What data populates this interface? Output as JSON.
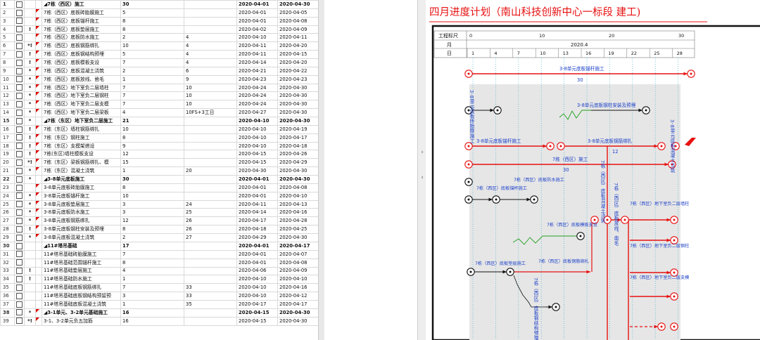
{
  "grid": {
    "rows": [
      {
        "n": "1",
        "mark": "",
        "tri": false,
        "sum": true,
        "name": "◢7栋（西区）施工",
        "dur": "30",
        "free": "",
        "start": "2020-04-01",
        "end": "2020-04-30"
      },
      {
        "n": "2",
        "mark": "",
        "tri": true,
        "sum": false,
        "name": "7栋（西区）底板砖胎膜施工",
        "dur": "5",
        "free": "",
        "start": "2020-04-01",
        "end": "2020-04-05"
      },
      {
        "n": "3",
        "mark": "",
        "tri": true,
        "sum": false,
        "name": "7栋（西区）底板锚杆施工",
        "dur": "8",
        "free": "",
        "start": "2020-04-01",
        "end": "2020-04-08"
      },
      {
        "n": "4",
        "mark": "!",
        "tri": true,
        "sum": false,
        "name": "7栋（西区）底板垫层施工",
        "dur": "8",
        "free": "",
        "start": "2020-04-02",
        "end": "2020-04-09"
      },
      {
        "n": "5",
        "mark": "",
        "tri": true,
        "sum": false,
        "name": "7栋（西区）底板防水施工",
        "dur": "2",
        "free": "4",
        "start": "2020-04-10",
        "end": "2020-04-11"
      },
      {
        "n": "6",
        "mark": "*!",
        "tri": true,
        "sum": false,
        "name": "7栋（西区）底板钢筋绑扎",
        "dur": "10",
        "free": "4",
        "start": "2020-04-11",
        "end": "2020-04-20"
      },
      {
        "n": "7",
        "mark": "!",
        "tri": true,
        "sum": false,
        "name": "7栋（西区）底板钢结构预埋",
        "dur": "5",
        "free": "4",
        "start": "2020-04-11",
        "end": "2020-04-15"
      },
      {
        "n": "8",
        "mark": "!",
        "tri": true,
        "sum": false,
        "name": "7栋（西区）底板模板支设",
        "dur": "7",
        "free": "4",
        "start": "2020-04-14",
        "end": "2020-04-20"
      },
      {
        "n": "9",
        "mark": "*",
        "tri": true,
        "sum": false,
        "name": "7栋（西区）底板混凝土浇筑",
        "dur": "2",
        "free": "6",
        "start": "2020-04-21",
        "end": "2020-04-22"
      },
      {
        "n": "10",
        "mark": "*",
        "tri": true,
        "sum": false,
        "name": "7栋（西区）底板放线、凿毛",
        "dur": "1",
        "free": "9",
        "start": "2020-04-23",
        "end": "2020-04-23"
      },
      {
        "n": "11",
        "mark": "*",
        "tri": true,
        "sum": false,
        "name": "7栋（西区）地下室负二层墙柱",
        "dur": "7",
        "free": "10",
        "start": "2020-04-24",
        "end": "2020-04-30"
      },
      {
        "n": "12",
        "mark": "*",
        "tri": true,
        "sum": false,
        "name": "7栋（西区）地下室负二层钢柱",
        "dur": "7",
        "free": "10",
        "start": "2020-04-24",
        "end": "2020-04-30"
      },
      {
        "n": "13",
        "mark": "*",
        "tri": true,
        "sum": false,
        "name": "7栋（西区）地下室负二层支模",
        "dur": "7",
        "free": "10",
        "start": "2020-04-24",
        "end": "2020-04-30"
      },
      {
        "n": "14",
        "mark": "*",
        "tri": true,
        "sum": false,
        "name": "7栋（西区）地下室负二层梁板",
        "dur": "4",
        "free": "10FS+3工日",
        "start": "2020-04-27",
        "end": "2020-04-30"
      },
      {
        "n": "15",
        "mark": "*",
        "tri": false,
        "sum": true,
        "name": "◢7栋（东区）地下室负二层施工",
        "dur": "21",
        "free": "",
        "start": "2020-04-10",
        "end": "2020-04-30"
      },
      {
        "n": "16",
        "mark": "!",
        "tri": true,
        "sum": false,
        "name": "7栋（东区）墙柱钢筋绑扎",
        "dur": "10",
        "free": "",
        "start": "2020-04-10",
        "end": "2020-04-19"
      },
      {
        "n": "17",
        "mark": "!",
        "tri": true,
        "sum": false,
        "name": "7栋（东区）钢柱施工",
        "dur": "8",
        "free": "",
        "start": "2020-04-10",
        "end": "2020-04-17"
      },
      {
        "n": "18",
        "mark": "!",
        "tri": true,
        "sum": false,
        "name": "7栋（东区）支模架搭设",
        "dur": "9",
        "free": "",
        "start": "2020-04-10",
        "end": "2020-04-18"
      },
      {
        "n": "19",
        "mark": "!",
        "tri": true,
        "sum": false,
        "name": "7栋(东区)墙柱模板支设",
        "dur": "12",
        "free": "",
        "start": "2020-04-15",
        "end": "2020-04-26"
      },
      {
        "n": "20",
        "mark": "*!",
        "tri": true,
        "sum": false,
        "name": "7栋（东区）梁板钢筋绑扎、模",
        "dur": "15",
        "free": "",
        "start": "2020-04-15",
        "end": "2020-04-29"
      },
      {
        "n": "21",
        "mark": "*",
        "tri": true,
        "sum": false,
        "name": "7栋（东区）混凝土浇筑",
        "dur": "1",
        "free": "20",
        "start": "2020-04-30",
        "end": "2020-04-30"
      },
      {
        "n": "22",
        "mark": "*",
        "tri": false,
        "sum": true,
        "name": "◢3-8单元底板施工",
        "dur": "30",
        "free": "",
        "start": "2020-04-01",
        "end": "2020-04-30"
      },
      {
        "n": "23",
        "mark": "",
        "tri": true,
        "sum": false,
        "name": "3-8单元底板砖胎膜施工",
        "dur": "8",
        "free": "",
        "start": "2020-04-01",
        "end": "2020-04-08"
      },
      {
        "n": "24",
        "mark": "*",
        "tri": true,
        "sum": false,
        "name": "3-8单元底板锚杆施工",
        "dur": "10",
        "free": "",
        "start": "2020-04-01",
        "end": "2020-04-10"
      },
      {
        "n": "25",
        "mark": "*",
        "tri": true,
        "sum": false,
        "name": "3-8单元底板垫层施工",
        "dur": "3",
        "free": "24",
        "start": "2020-04-11",
        "end": "2020-04-13"
      },
      {
        "n": "26",
        "mark": "*",
        "tri": true,
        "sum": false,
        "name": "3-8单元底板防水施工",
        "dur": "3",
        "free": "25",
        "start": "2020-04-14",
        "end": "2020-04-16"
      },
      {
        "n": "27",
        "mark": "*",
        "tri": true,
        "sum": false,
        "name": "3-8单元底板钢筋绑扎",
        "dur": "12",
        "free": "26",
        "start": "2020-04-17",
        "end": "2020-04-28"
      },
      {
        "n": "28",
        "mark": "!",
        "tri": true,
        "sum": false,
        "name": "3-8单元底板钢柱安装及预埋",
        "dur": "8",
        "free": "26",
        "start": "2020-04-18",
        "end": "2020-04-25"
      },
      {
        "n": "29",
        "mark": "*",
        "tri": true,
        "sum": false,
        "name": "3-8单元底板混凝土浇筑",
        "dur": "2",
        "free": "27",
        "start": "2020-04-29",
        "end": "2020-04-30"
      },
      {
        "n": "30",
        "mark": "",
        "tri": false,
        "sum": true,
        "name": "◢11#塔吊基础",
        "dur": "17",
        "free": "",
        "start": "2020-04-01",
        "end": "2020-04-17"
      },
      {
        "n": "31",
        "mark": "",
        "tri": false,
        "sum": false,
        "name": "11#塔吊基础砖胎膜施工",
        "dur": "7",
        "free": "",
        "start": "2020-04-01",
        "end": "2020-04-07"
      },
      {
        "n": "32",
        "mark": "",
        "tri": false,
        "sum": false,
        "name": "11#塔吊基础范围锚杆施工",
        "dur": "8",
        "free": "",
        "start": "2020-04-01",
        "end": "2020-04-08"
      },
      {
        "n": "33",
        "mark": "!",
        "tri": false,
        "sum": false,
        "name": "11#塔吊基础垫层施工",
        "dur": "4",
        "free": "",
        "start": "2020-04-06",
        "end": "2020-04-09"
      },
      {
        "n": "34",
        "mark": "!",
        "tri": false,
        "sum": false,
        "name": "11#塔吊基础防水施工",
        "dur": "1",
        "free": "",
        "start": "2020-04-10",
        "end": "2020-04-10"
      },
      {
        "n": "35",
        "mark": "",
        "tri": false,
        "sum": false,
        "name": "11#塔吊基础底板钢筋绑扎",
        "dur": "7",
        "free": "33",
        "start": "2020-04-10",
        "end": "2020-04-16"
      },
      {
        "n": "36",
        "mark": "",
        "tri": false,
        "sum": false,
        "name": "11#塔吊基础底板钢结构预留预",
        "dur": "3",
        "free": "33",
        "start": "2020-04-10",
        "end": "2020-04-12"
      },
      {
        "n": "37",
        "mark": "",
        "tri": false,
        "sum": false,
        "name": "11#塔吊基础底板混凝土浇筑",
        "dur": "1",
        "free": "35",
        "start": "2020-04-17",
        "end": "2020-04-17"
      },
      {
        "n": "38",
        "mark": "*",
        "tri": true,
        "sum": true,
        "name": "◢3-1单元、3-2单元基础施工",
        "dur": "16",
        "free": "",
        "start": "2020-04-15",
        "end": "2020-04-30"
      },
      {
        "n": "39",
        "mark": "*!",
        "tri": true,
        "sum": false,
        "name": "3-1、3-2单元负五加筋",
        "dur": "16",
        "free": "",
        "start": "2020-04-15",
        "end": "2020-04-30"
      }
    ]
  },
  "chart": {
    "title": "四月进度计划（南山科技创新中心一标段 建工)",
    "scale_label": "工程标尺",
    "month_label": "月",
    "day_label": "日",
    "month_value": "2020.4",
    "scale_ticks": [
      "0",
      "10",
      "20",
      "30"
    ],
    "days": [
      "1",
      "4",
      "7",
      "10",
      "13",
      "16",
      "19",
      "22",
      "25",
      "28"
    ],
    "colors": {
      "critical": "#e81010",
      "normal": "#111111",
      "free": "#20a020",
      "blue": "#1a3fc8",
      "shade": "#e6e6e6",
      "grid": "#30a8c8"
    },
    "labels": {
      "a1": "3-8单元底板锚杆施工",
      "a1d": "30",
      "a2": "3-8单元底板砖胎膜施工",
      "a3": "3-8单元底板钢柱安装及预埋",
      "a4": "3-8单元底板锚杆施工",
      "a5": "3-8单元底板钢筋绑扎",
      "a5d": "12",
      "a6": "3-8单元底板混凝土浇筑",
      "a7": "7栋（西区）施工",
      "a7d": "30",
      "b1": "7栋（西区）底板锚杆施工",
      "b2": "7栋（西区）底板防水施工",
      "b3": "7栋（西区）底板模板支设",
      "b4": "7栋（西区）底板垫层施工",
      "b5": "7栋（西区）底板钢筋绑扎",
      "b6": "7栋（西区）底板钢结构预埋",
      "b7": "7栋（西区）底板混凝土浇筑",
      "b8": "7栋（西区）底板放线、凿毛",
      "b9": "7栋（西区）地下室负二层墙柱",
      "b10": "7栋（西区）地下室负二层钢柱",
      "b11": "7栋（西区）地下室负二层支模"
    }
  }
}
